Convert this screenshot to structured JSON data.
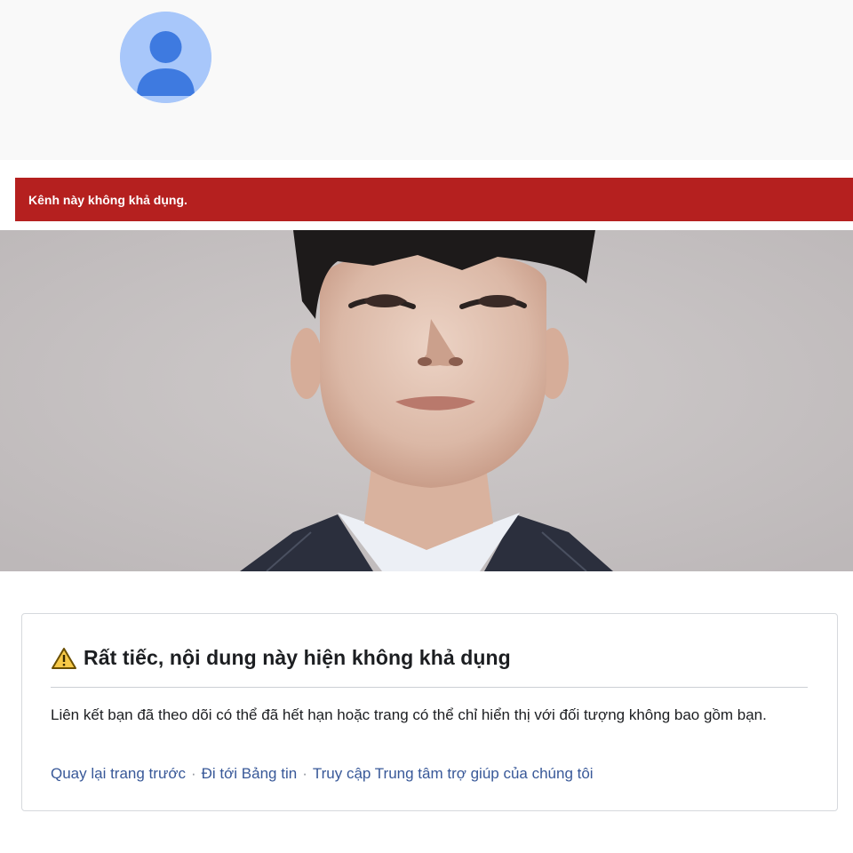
{
  "profile": {
    "avatar_icon": "default-user-avatar-icon",
    "avatar_bg": "#a8c7fa",
    "avatar_fg": "#3e7ae0"
  },
  "alert": {
    "text": "Kênh này không khả dụng.",
    "bg_color": "#b5201f"
  },
  "banner": {
    "image": "portrait-photo-man-in-suit"
  },
  "error": {
    "icon": "warning-icon",
    "title": "Rất tiếc, nội dung này hiện không khả dụng",
    "message": "Liên kết bạn đã theo dõi có thể đã hết hạn hoặc trang có thể chỉ hiển thị với đối tượng không bao gồm bạn.",
    "links": [
      {
        "label": "Quay lại trang trước"
      },
      {
        "label": "Đi tới Bảng tin"
      },
      {
        "label": "Truy cập Trung tâm trợ giúp của chúng tôi"
      }
    ],
    "separator": "·",
    "link_color": "#385898"
  }
}
